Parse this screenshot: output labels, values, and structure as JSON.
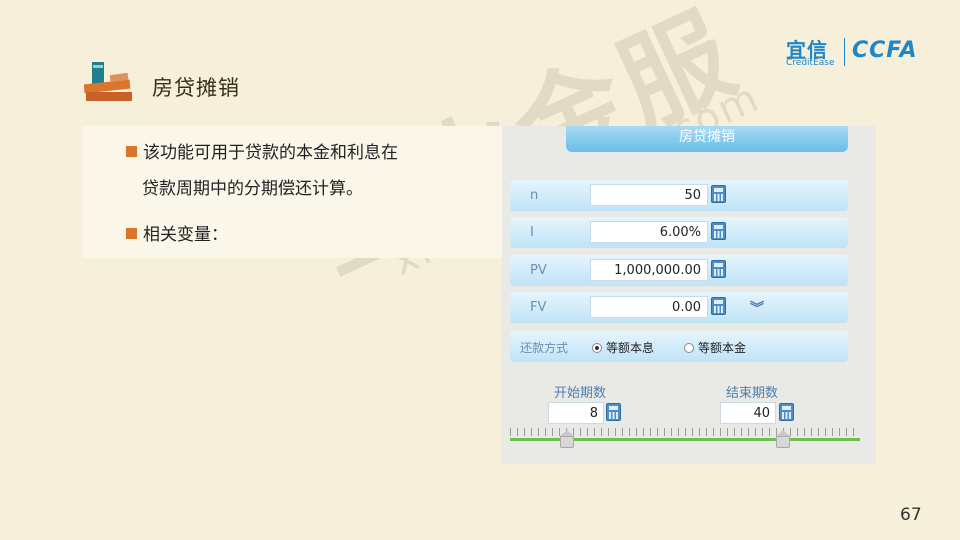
{
  "header": {
    "title": "房贷摊销"
  },
  "logo": {
    "cn": "宜信",
    "en": "CreditEase",
    "partner": "CCFA"
  },
  "bullets": {
    "b1_line1": "该功能可用于贷款的本金和利息在",
    "b1_line2": "贷款周期中的分期偿还计算。",
    "b2": "相关变量："
  },
  "calculator": {
    "title": "房贷摊销",
    "rows": [
      {
        "label": "n",
        "value": "50"
      },
      {
        "label": "I",
        "value": "6.00%"
      },
      {
        "label": "PV",
        "value": "1,000,000.00"
      },
      {
        "label": "FV",
        "value": "0.00"
      }
    ],
    "repay_label": "还款方式",
    "options": [
      {
        "label": "等额本息",
        "selected": true
      },
      {
        "label": "等额本金",
        "selected": false
      }
    ],
    "start_label": "开始期数",
    "start_value": "8",
    "end_label": "结束期数",
    "end_value": "40"
  },
  "watermark": {
    "cn": "星火金服",
    "en": "xinghuo.yixin.com"
  },
  "page_number": "67",
  "colors": {
    "accent": "#d9762b",
    "brand": "#1f86c8",
    "slider": "#6fbd4a"
  }
}
